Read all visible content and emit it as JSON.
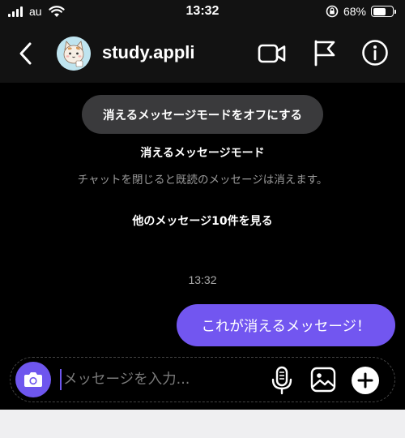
{
  "status_bar": {
    "carrier": "au",
    "time": "13:32",
    "battery_percent": "68%",
    "battery_level": 0.68,
    "icons": [
      "signal-icon",
      "wifi-icon",
      "rotation-lock-icon",
      "battery-icon"
    ]
  },
  "header": {
    "username": "study.appli",
    "icons": [
      "back-icon",
      "avatar",
      "video-call-icon",
      "flag-icon",
      "info-icon"
    ]
  },
  "chat": {
    "turn_off_button": "消えるメッセージモードをオフにする",
    "mode_title": "消えるメッセージモード",
    "mode_description": "チャットを閉じると既読のメッセージは消えます。",
    "see_more_link": "他のメッセージ10件を見る",
    "timestamp": "13:32",
    "messages": [
      {
        "text": "これが消えるメッセージ！",
        "from": "me"
      }
    ]
  },
  "composer": {
    "placeholder": "メッセージを入力...",
    "icons": [
      "camera-icon",
      "mic-icon",
      "image-icon",
      "plus-icon"
    ]
  },
  "colors": {
    "accent": "#7256f0",
    "background": "#000000",
    "header_background": "#121212",
    "pill_background": "#3a3a3c"
  }
}
